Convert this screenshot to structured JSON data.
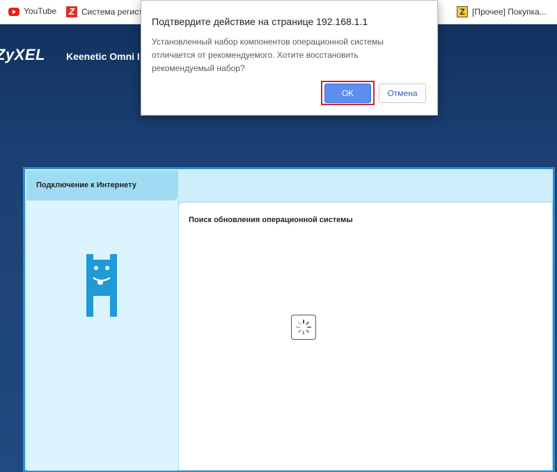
{
  "bookmarks": [
    {
      "icon": "youtube-icon",
      "label": "YouTube"
    },
    {
      "icon": "z-site-icon",
      "label": "Система регистр"
    },
    {
      "icon": "z-folder-icon",
      "label": "[Прочее] Покупка..."
    }
  ],
  "header": {
    "brand": "ZyXEL",
    "model": "Keenetic Omni I"
  },
  "panel": {
    "tab_label": "Подключение к Интернету",
    "content_title": "Поиск обновления операционной системы"
  },
  "dialog": {
    "title": "Подтвердите действие на странице 192.168.1.1",
    "message_line1": "Установленный набор компонентов операционной системы",
    "message_line2": "отличается от рекомендуемого. Хотите восстановить",
    "message_line3": "рекомендуемый набор?",
    "ok_label": "OK",
    "cancel_label": "Отмена"
  },
  "colors": {
    "background": "#1b3f72",
    "panel_border": "#2a8fd0",
    "mascot": "#1e9ad6",
    "ok_button": "#5b8ef0",
    "highlight": "#d0222b"
  }
}
